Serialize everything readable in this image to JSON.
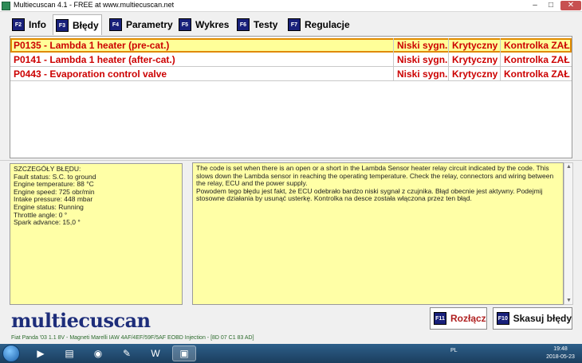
{
  "window": {
    "title": "Multiecuscan 4.1 - FREE at www.multiecuscan.net",
    "minimize_glyph": "–",
    "maximize_glyph": "□",
    "close_glyph": "✕"
  },
  "tabs": [
    {
      "key": "F2",
      "label": "Info"
    },
    {
      "key": "F3",
      "label": "Błędy"
    },
    {
      "key": "F4",
      "label": "Parametry"
    },
    {
      "key": "F5",
      "label": "Wykres"
    },
    {
      "key": "F6",
      "label": "Testy"
    },
    {
      "key": "F7",
      "label": "Regulacje"
    }
  ],
  "active_tab": "Błędy",
  "faults": [
    {
      "code_desc": "P0135 - Lambda 1 heater (pre-cat.)",
      "signal": "Niski sygn.",
      "severity": "Krytyczny",
      "lamp": "Kontrolka ZAŁ"
    },
    {
      "code_desc": "P0141 - Lambda 1 heater (after-cat.)",
      "signal": "Niski sygn.",
      "severity": "Krytyczny",
      "lamp": "Kontrolka ZAŁ"
    },
    {
      "code_desc": "P0443 - Evaporation control valve",
      "signal": "Niski sygn.",
      "severity": "Krytyczny",
      "lamp": "Kontrolka ZAŁ"
    }
  ],
  "details": {
    "heading": "SZCZEGÓŁY BŁĘDU:",
    "lines": [
      "Fault status: S.C. to ground",
      "Engine temperature: 88 °C",
      "Engine speed: 725 obr/min",
      "Intake pressure: 448 mbar",
      "Engine status: Running",
      "Throttle angle: 0 °",
      "Spark advance: 15,0 °"
    ]
  },
  "description": {
    "p1": "The code is set when there is an open or a short in the Lambda Sensor heater relay circuit indicated by the code. This slows down the Lambda sensor in reaching the operating temperature. Check the relay, connectors and wiring between the relay, ECU and the power supply.",
    "p2": "Powodem tego błędu jest fakt, że ECU odebrało bardzo niski sygnał z czujnika. Błąd obecnie jest aktywny. Podejmij stosowne działania by usunąć usterkę. Kontrolka na desce została włączona przez ten błąd."
  },
  "logo": "multiecuscan",
  "buttons": {
    "disconnect": {
      "key": "F11",
      "label": "Rozłącz"
    },
    "clear": {
      "key": "F10",
      "label": "Skasuj błędy"
    }
  },
  "status": "Fiat Panda '03 1.1 8V - Magneti Marelli IAW 4AF/4EF/59F/5AF EOBD Injection - [8D 07 C1 83 AD]",
  "taskbar": {
    "tray_lang": "PL",
    "time": "19:48",
    "date": "2018-05-23"
  },
  "colors": {
    "fault_text": "#cc0000",
    "selected_row": "#ffff99",
    "panel_bg": "#ffffa6",
    "fkey_bg": "#18207a",
    "logo": "#1d2d7a"
  }
}
